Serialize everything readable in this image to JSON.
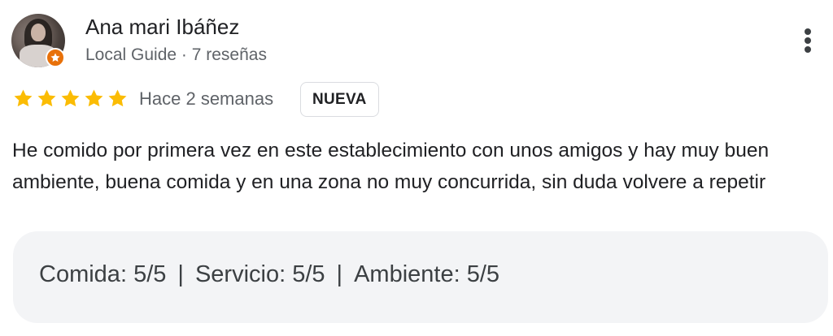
{
  "reviewer": {
    "name": "Ana mari Ibáñez",
    "meta": "Local Guide · 7 reseñas",
    "avatar_icon": "user-avatar",
    "badge_icon": "local-guide-star-icon"
  },
  "menu": {
    "icon": "more-vert-icon"
  },
  "rating": {
    "stars": 5,
    "max": 5,
    "star_color": "#fbbc04"
  },
  "time": "Hace 2 semanas",
  "badge": "NUEVA",
  "review_text": "He comido por primera vez en este establecimiento con unos amigos y hay muy buen ambiente, buena comida y en una zona no muy concurrida, sin duda volvere a repetir",
  "sub_ratings": [
    {
      "label": "Comida",
      "value": "5/5"
    },
    {
      "label": "Servicio",
      "value": "5/5"
    },
    {
      "label": "Ambiente",
      "value": "5/5"
    }
  ],
  "separator": "|",
  "colon": ":"
}
